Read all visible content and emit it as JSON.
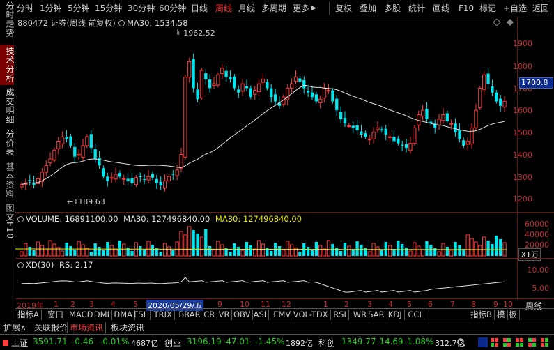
{
  "left_tabs": [
    {
      "label": "分时走势",
      "active": false
    },
    {
      "label": "技术分析",
      "active": true
    },
    {
      "label": "成交明细",
      "active": false
    },
    {
      "label": "分价表",
      "active": false
    },
    {
      "label": "基本资料",
      "active": false
    },
    {
      "label": "图文F10",
      "active": false
    }
  ],
  "toolbar": {
    "periods": [
      "分时",
      "1分钟",
      "5分钟",
      "15分钟",
      "30分钟",
      "60分钟",
      "日线",
      "周线",
      "月线",
      "多周期",
      "更多"
    ],
    "active_period": "周线",
    "more_arrow": "▶",
    "actions": [
      "复权",
      "叠加",
      "多股",
      "统计",
      "画线",
      "F10",
      "标记",
      "+自选",
      "返回"
    ]
  },
  "main_header": {
    "code_name": "880472 证券(周线 前复权)",
    "ma_label": "MA30: 1534.58"
  },
  "annotations": {
    "high": "1962.52",
    "low": "1189.63"
  },
  "price_axis": [
    "1900",
    "1800",
    "1700",
    "1600",
    "1500",
    "1400",
    "1300",
    "1200"
  ],
  "price_tag": "1700.8",
  "volume_header": {
    "volume": "VOLUME: 16891100.00",
    "ma30_white": "MA30: 127496840.00",
    "ma30_yellow": "MA30: 127496840.00"
  },
  "volume_axis": [
    "60000",
    "40000",
    "20000"
  ],
  "volume_unit": "X1万",
  "xd_header": {
    "xd": "XD(30)",
    "rs": "RS: 2.17"
  },
  "xd_axis": [
    "10.00",
    "5.00"
  ],
  "x_axis": {
    "labels": [
      "2019年",
      "1",
      "2",
      "3",
      "4",
      "5",
      "2020/05/29/五",
      "9",
      "10",
      "11",
      "12",
      "1",
      "2",
      "3",
      "4",
      "5",
      "6",
      "7",
      "8",
      "9",
      "10"
    ],
    "period_label": "周线"
  },
  "indicators": [
    "指标A",
    "窗口",
    "MACD",
    "DMI",
    "DMA",
    "FSL",
    "TRIX",
    "BRAR",
    "CR",
    "VR",
    "OBV",
    "ASI",
    "EMV",
    "VOL-TDX",
    "RSI",
    "WR",
    "SAR",
    "KDJ",
    "CCI"
  ],
  "indicator_right": [
    "指标B",
    "模",
    "板"
  ],
  "bottom_tabs": [
    {
      "label": "扩展∧",
      "active": false
    },
    {
      "label": "关联报价",
      "active": false
    },
    {
      "label": "市场资讯",
      "active": true
    },
    {
      "label": "板块资讯",
      "active": false
    }
  ],
  "status": {
    "sh": {
      "name": "上证",
      "price": "3591.71",
      "chg": "-0.46",
      "pct": "-0.01%",
      "amt": "4687亿"
    },
    "cy": {
      "name": "创业",
      "price": "3196.19",
      "chg": "-47.01",
      "pct": "-1.45%",
      "amt": "1892亿"
    },
    "kc": {
      "name": "科创",
      "price": "1349.77",
      "chg": "-14.69",
      "pct": "-1.08%",
      "amt": "312.7亿"
    }
  },
  "colors": {
    "up": "#ff3b3b",
    "down": "#00e5ee",
    "ma": "#e0e0e0",
    "axis": "#7a1010"
  }
}
